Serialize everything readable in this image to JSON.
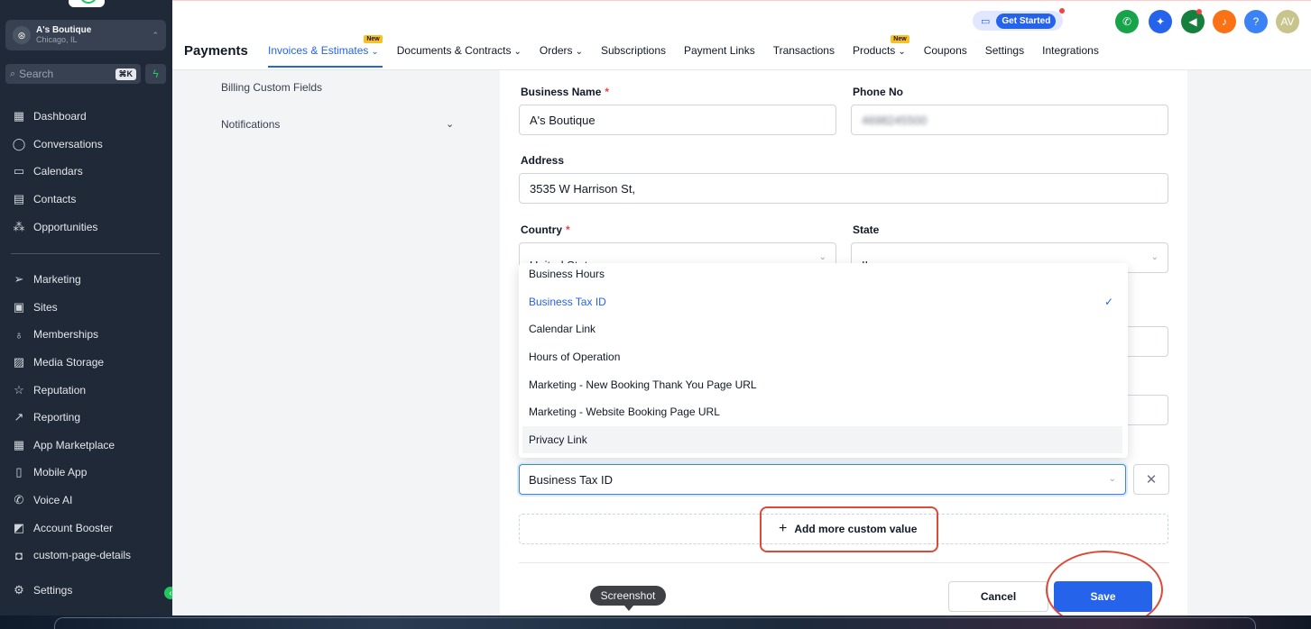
{
  "sidebar": {
    "location_name": "A's Boutique",
    "location_city": "Chicago, IL",
    "search_placeholder": "Search",
    "search_shortcut": "⌘K",
    "items_top": [
      {
        "label": "Dashboard",
        "icon": "dashboard-icon"
      },
      {
        "label": "Conversations",
        "icon": "chat-icon"
      },
      {
        "label": "Calendars",
        "icon": "calendar-icon"
      },
      {
        "label": "Contacts",
        "icon": "contacts-icon"
      },
      {
        "label": "Opportunities",
        "icon": "opportunities-icon"
      }
    ],
    "items_bottom": [
      {
        "label": "Marketing",
        "icon": "send-icon"
      },
      {
        "label": "Sites",
        "icon": "sites-icon"
      },
      {
        "label": "Memberships",
        "icon": "badge-icon"
      },
      {
        "label": "Media Storage",
        "icon": "image-icon"
      },
      {
        "label": "Reputation",
        "icon": "star-icon"
      },
      {
        "label": "Reporting",
        "icon": "trend-icon"
      },
      {
        "label": "App Marketplace",
        "icon": "grid-icon"
      },
      {
        "label": "Mobile App",
        "icon": "mobile-icon"
      },
      {
        "label": "Voice AI",
        "icon": "phone-icon"
      },
      {
        "label": "Account Booster",
        "icon": "booster-icon"
      },
      {
        "label": "custom-page-details",
        "icon": "page-icon"
      },
      {
        "label": "Settings",
        "icon": "gear-icon"
      }
    ]
  },
  "header": {
    "get_started": "Get Started",
    "page_title": "Payments",
    "tabs": [
      {
        "label": "Invoices & Estimates",
        "badge": "New",
        "chevron": true,
        "active": true
      },
      {
        "label": "Documents & Contracts",
        "chevron": true
      },
      {
        "label": "Orders",
        "chevron": true
      },
      {
        "label": "Subscriptions"
      },
      {
        "label": "Payment Links"
      },
      {
        "label": "Transactions"
      },
      {
        "label": "Products",
        "badge": "New",
        "chevron": true
      },
      {
        "label": "Coupons"
      },
      {
        "label": "Settings"
      },
      {
        "label": "Integrations"
      }
    ],
    "avatar_initials": "AV",
    "colors": {
      "accent": "#2563eb",
      "phone": "#16a34a",
      "alert": "#f97316",
      "avatar": "#b9b98a"
    }
  },
  "settings_menu": {
    "billing_custom_fields": "Billing Custom Fields",
    "notifications": "Notifications"
  },
  "form": {
    "business_name_label": "Business Name",
    "business_name_value": "A's Boutique",
    "phone_label": "Phone No",
    "phone_value": "4698245500",
    "address_label": "Address",
    "address_value": "3535 W Harrison St,",
    "country_label": "Country",
    "country_value": "United States",
    "state_label": "State",
    "state_value": "IL",
    "required_mark": "*",
    "custom_value_selected": "Business Tax ID",
    "add_more": "Add more custom value",
    "cancel": "Cancel",
    "save": "Save"
  },
  "dropdown": {
    "options": [
      {
        "label": "Business Hours"
      },
      {
        "label": "Business Tax ID",
        "selected": true
      },
      {
        "label": "Calendar Link"
      },
      {
        "label": "Hours of Operation"
      },
      {
        "label": "Marketing - New Booking Thank You Page URL"
      },
      {
        "label": "Marketing - Website Booking Page URL"
      },
      {
        "label": "Privacy Link",
        "hovered": true
      }
    ]
  },
  "tooltip": "Screenshot"
}
